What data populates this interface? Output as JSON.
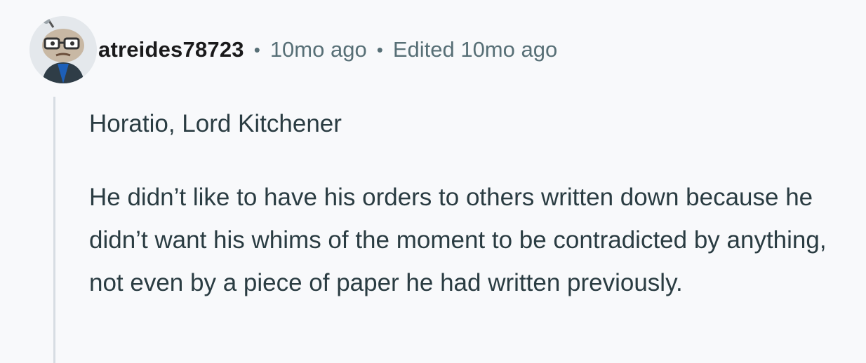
{
  "comment": {
    "author": "atreides78723",
    "separator": "•",
    "posted_time": "10mo ago",
    "edited_label": "Edited 10mo ago",
    "paragraphs": [
      "Horatio, Lord Kitchener",
      "He didn’t like to have his orders to others written down because he didn’t want his whims of the moment to be contradicted by anything, not even by a piece of paper he had written previously."
    ]
  },
  "colors": {
    "background": "#f8f9fb",
    "meta_text": "#576f76",
    "body_text": "#2a3c42",
    "thread_line": "#d7dde3"
  },
  "icons": {
    "avatar": "snoo-avatar-with-glasses"
  }
}
